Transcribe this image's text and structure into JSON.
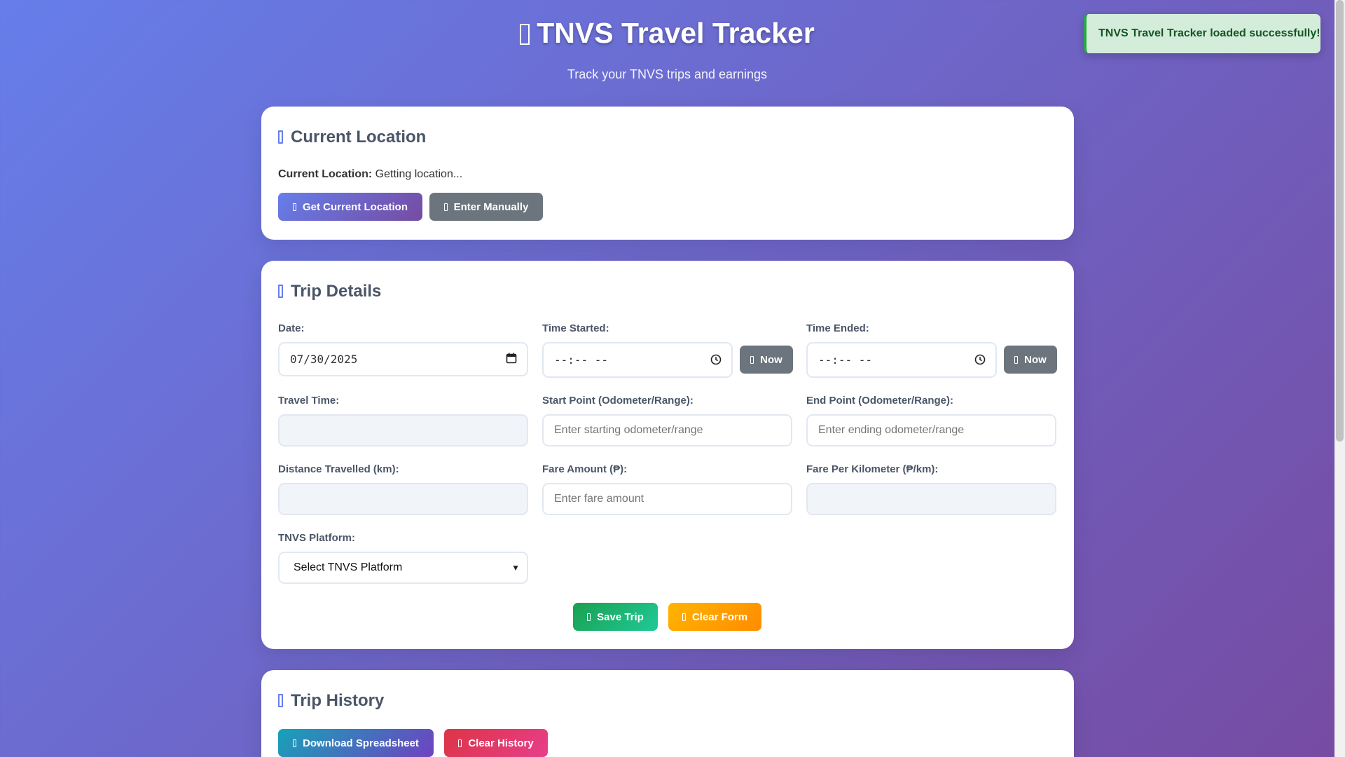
{
  "header": {
    "title": "TNVS Travel Tracker",
    "subtitle": "Track your TNVS trips and earnings"
  },
  "toast": {
    "message": "TNVS Travel Tracker loaded successfully!"
  },
  "location": {
    "section_title": "Current Location",
    "label": "Current Location:",
    "value": "Getting location...",
    "get_button": "Get Current Location",
    "manual_button": "Enter Manually"
  },
  "trip": {
    "section_title": "Trip Details",
    "date_label": "Date:",
    "date_value": "07/30/2025",
    "time_started_label": "Time Started:",
    "time_started_value": "--:-- --",
    "time_ended_label": "Time Ended:",
    "time_ended_value": "--:-- --",
    "now_label": "Now",
    "travel_time_label": "Travel Time:",
    "start_point_label": "Start Point (Odometer/Range):",
    "start_point_placeholder": "Enter starting odometer/range",
    "end_point_label": "End Point (Odometer/Range):",
    "end_point_placeholder": "Enter ending odometer/range",
    "distance_label": "Distance Travelled (km):",
    "fare_label": "Fare Amount (₱):",
    "fare_placeholder": "Enter fare amount",
    "fare_per_km_label": "Fare Per Kilometer (₱/km):",
    "platform_label": "TNVS Platform:",
    "platform_selected": "Select TNVS Platform",
    "save_button": "Save Trip",
    "clear_button": "Clear Form"
  },
  "history": {
    "section_title": "Trip History",
    "download_button": "Download Spreadsheet",
    "clear_button": "Clear History"
  },
  "colors": {
    "background_start": "#667eea",
    "background_end": "#764ba2",
    "success": "#28a745",
    "danger": "#dc3545",
    "warning": "#ffb400"
  }
}
